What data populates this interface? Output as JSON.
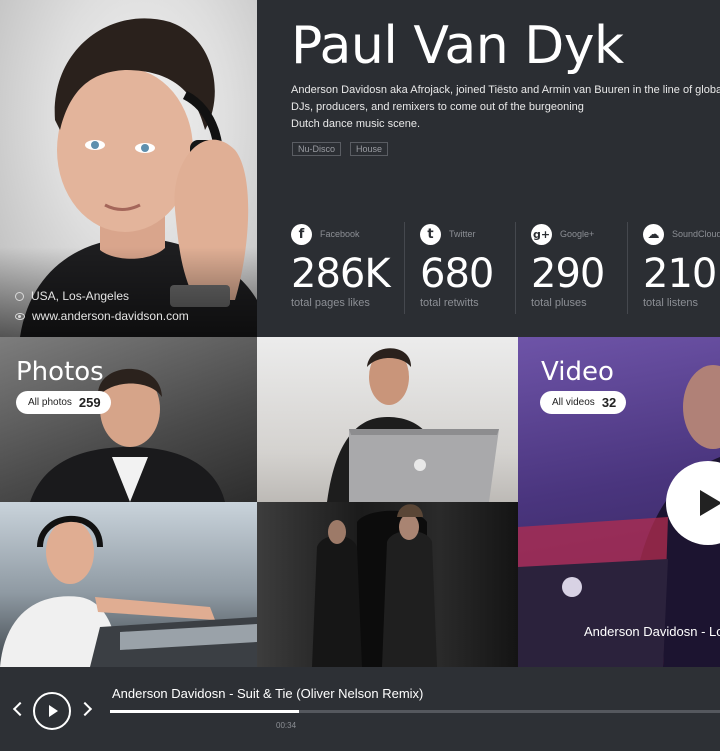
{
  "artist": {
    "name": "Paul Van Dyk",
    "bio_lines": [
      "Anderson Davidosn aka Afrojack, joined Tiësto and Armin van Buuren in the line of global",
      "DJs, producers, and remixers to come out of the burgeoning",
      "Dutch dance music scene."
    ],
    "tags": [
      "Nu-Disco",
      "House"
    ],
    "location": "USA, Los-Angeles",
    "website": "www.anderson-davidson.com"
  },
  "stats": [
    {
      "network": "Facebook",
      "icon": "facebook-icon",
      "glyph": "f",
      "value": "286K",
      "caption": "total pages likes"
    },
    {
      "network": "Twitter",
      "icon": "twitter-icon",
      "glyph": "t",
      "value": "680",
      "caption": "total retwitts"
    },
    {
      "network": "Google+",
      "icon": "google-plus-icon",
      "glyph": "g+",
      "value": "290",
      "caption": "total pluses"
    },
    {
      "network": "SoundCloud",
      "icon": "soundcloud-icon",
      "glyph": "☁",
      "value": "210",
      "caption": "total listens"
    }
  ],
  "gallery": {
    "photos": {
      "title": "Photos",
      "count_label": "All photos",
      "count": "259"
    },
    "video": {
      "title": "Video",
      "count_label": "All videos",
      "count": "32",
      "caption": "Anderson Davidosn - Lo"
    }
  },
  "player": {
    "track": "Anderson Davidosn - Suit & Tie (Oliver Nelson Remix)",
    "time": "00:34",
    "progress": 0.31
  },
  "colors": {
    "background": "#2b2e33",
    "accent": "#ffffff",
    "muted_text": "#8c8f95",
    "video_tint": "#5a3f95"
  }
}
